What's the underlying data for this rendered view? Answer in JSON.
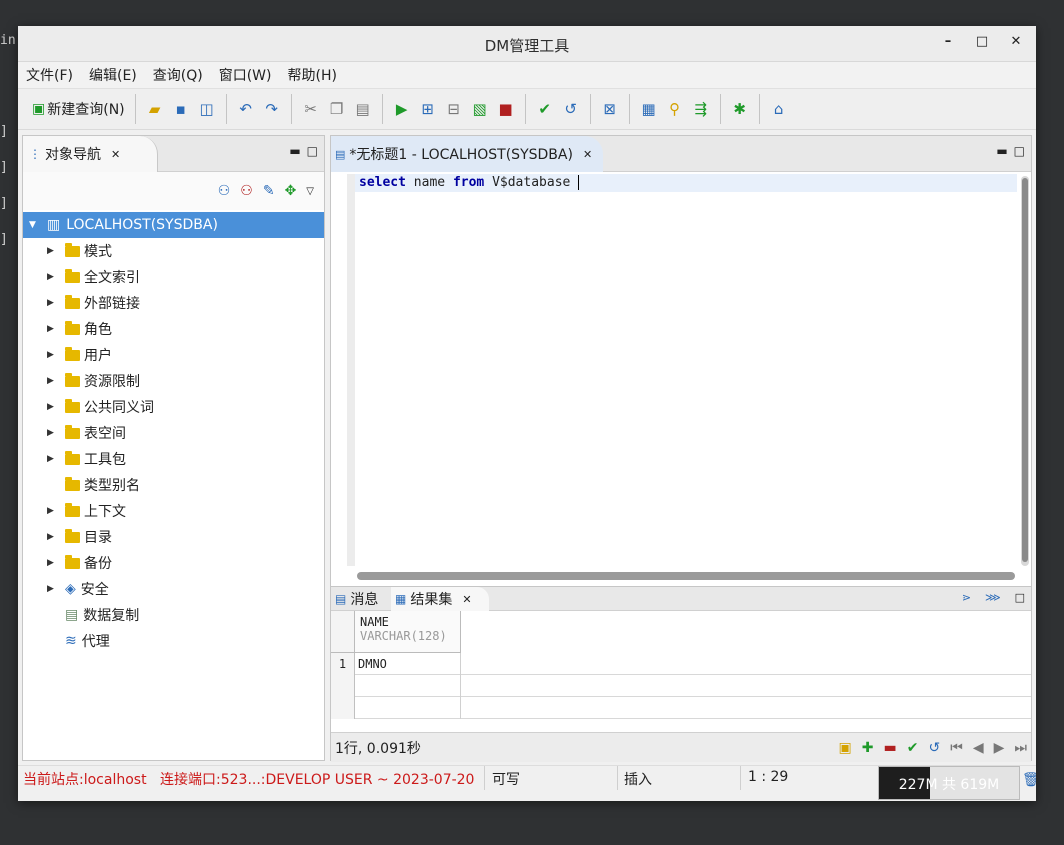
{
  "desktop": {
    "side_text": "in"
  },
  "window": {
    "title": "DM管理工具",
    "minimize": "–",
    "maximize": "□",
    "close": "✕"
  },
  "menu": [
    "文件(F)",
    "编辑(E)",
    "查询(Q)",
    "窗口(W)",
    "帮助(H)"
  ],
  "toolbar": {
    "new_query_label": "新建查询(N)"
  },
  "left_panel": {
    "tab_label": "对象导航",
    "root": "LOCALHOST(SYSDBA)",
    "items": [
      {
        "label": "模式",
        "expandable": true
      },
      {
        "label": "全文索引",
        "expandable": true
      },
      {
        "label": "外部链接",
        "expandable": true
      },
      {
        "label": "角色",
        "expandable": true
      },
      {
        "label": "用户",
        "expandable": true
      },
      {
        "label": "资源限制",
        "expandable": true
      },
      {
        "label": "公共同义词",
        "expandable": true
      },
      {
        "label": "表空间",
        "expandable": true
      },
      {
        "label": "工具包",
        "expandable": true
      },
      {
        "label": "类型别名",
        "expandable": false
      },
      {
        "label": "上下文",
        "expandable": true
      },
      {
        "label": "目录",
        "expandable": true
      },
      {
        "label": "备份",
        "expandable": true
      },
      {
        "label": "安全",
        "expandable": true
      },
      {
        "label": "数据复制",
        "expandable": false
      },
      {
        "label": "代理",
        "expandable": false
      }
    ]
  },
  "editor": {
    "tab_label": "*无标题1 - LOCALHOST(SYSDBA)",
    "kw1": "select",
    "mid1": " name ",
    "kw2": "from",
    "rest": " V$database "
  },
  "results": {
    "tab_messages": "消息",
    "tab_resultset": "结果集",
    "column_name": "NAME",
    "column_type": "VARCHAR(128)",
    "rows": [
      {
        "num": "1",
        "name": "DMNO"
      }
    ],
    "status": "1行, 0.091秒"
  },
  "statusbar": {
    "site": "当前站点:localhost",
    "port": "连接端口:523...:DEVELOP USER ~ 2023-07-20",
    "mode": "可写",
    "insert": "插入",
    "position": "1 : 29",
    "memory": "227M 共 619M",
    "memory_used_fraction": 0.367
  }
}
